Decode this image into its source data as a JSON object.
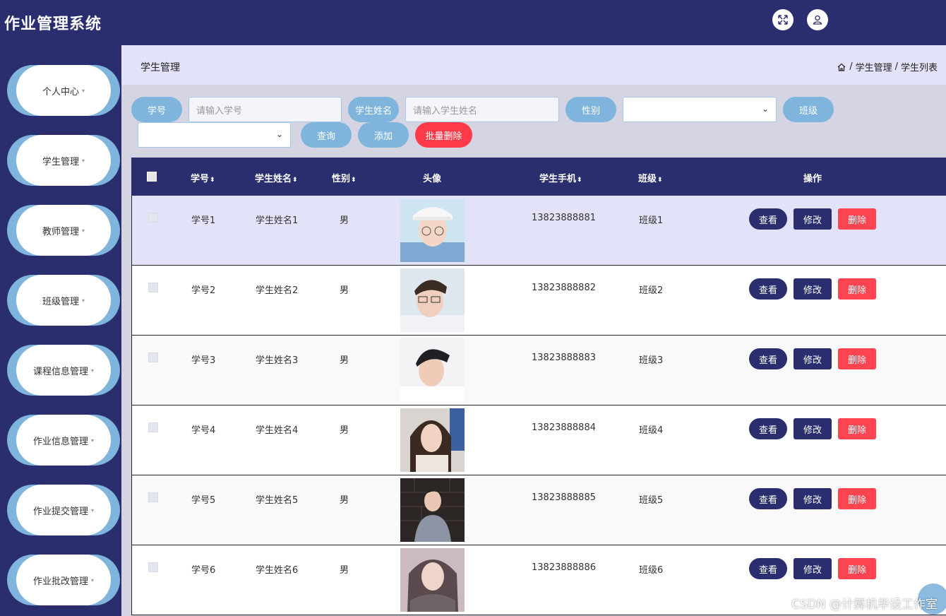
{
  "app": {
    "title": "作业管理系统"
  },
  "header": {
    "fullscreen_icon": "expand-icon",
    "user_icon": "user-icon"
  },
  "sidebar": {
    "items": [
      {
        "label": "个人中心"
      },
      {
        "label": "学生管理"
      },
      {
        "label": "教师管理"
      },
      {
        "label": "班级管理"
      },
      {
        "label": "课程信息管理"
      },
      {
        "label": "作业信息管理"
      },
      {
        "label": "作业提交管理"
      },
      {
        "label": "作业批改管理"
      }
    ],
    "caret": "▾"
  },
  "breadcrumb": {
    "title": "学生管理",
    "home_icon": "home-icon",
    "sep": "/",
    "level1": "学生管理",
    "level2": "学生列表"
  },
  "search": {
    "xuehao_label": "学号",
    "xuehao_placeholder": "请输入学号",
    "name_label": "学生姓名",
    "name_placeholder": "请输入学生姓名",
    "gender_label": "性别",
    "gender_value": "",
    "class_label": "班级",
    "class_value": "",
    "query_btn": "查询",
    "add_btn": "添加",
    "batch_delete_btn": "批量删除"
  },
  "table": {
    "columns": {
      "xuehao": "学号",
      "name": "学生姓名",
      "gender": "性别",
      "avatar": "头像",
      "phone": "学生手机",
      "class": "班级",
      "actions": "操作"
    },
    "sort_icon": "⬍",
    "action_labels": {
      "view": "查看",
      "edit": "修改",
      "delete": "删除"
    },
    "rows": [
      {
        "xuehao": "学号1",
        "name": "学生姓名1",
        "gender": "男",
        "phone": "13823888881",
        "class": "班级1"
      },
      {
        "xuehao": "学号2",
        "name": "学生姓名2",
        "gender": "男",
        "phone": "13823888882",
        "class": "班级2"
      },
      {
        "xuehao": "学号3",
        "name": "学生姓名3",
        "gender": "男",
        "phone": "13823888883",
        "class": "班级3"
      },
      {
        "xuehao": "学号4",
        "name": "学生姓名4",
        "gender": "男",
        "phone": "13823888884",
        "class": "班级4"
      },
      {
        "xuehao": "学号5",
        "name": "学生姓名5",
        "gender": "男",
        "phone": "13823888885",
        "class": "班级5"
      },
      {
        "xuehao": "学号6",
        "name": "学生姓名6",
        "gender": "男",
        "phone": "13823888886",
        "class": "班级6"
      }
    ]
  },
  "watermark": "CSDN @计算机毕设工作室",
  "colors": {
    "header_bg": "#2a2d6e",
    "accent_blue": "#7fb4dc",
    "danger_red": "#ff4451",
    "row_highlight": "#e2e3f8"
  }
}
